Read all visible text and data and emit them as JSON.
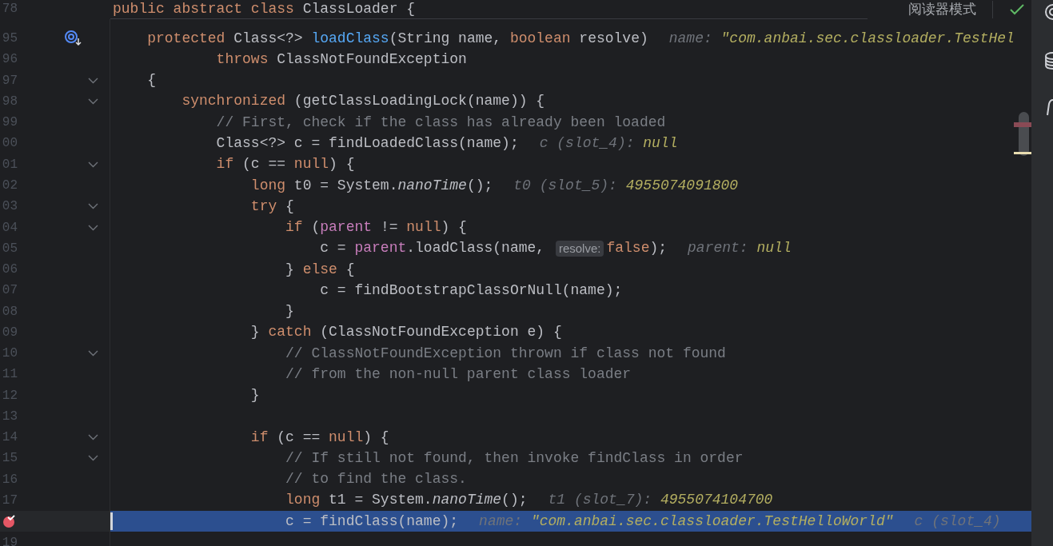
{
  "sticky_header": {
    "number": "78",
    "segments": [
      {
        "kind": "keyword",
        "text": "public abstract class "
      },
      {
        "kind": "plain",
        "text": "ClassLoader {"
      }
    ]
  },
  "editor_toolbar": {
    "reader_mode": "阅读器模式"
  },
  "lines": [
    {
      "number": "95",
      "gutter_icon": {
        "kind": "method_breakpoint"
      },
      "foldable": false,
      "highlighted": false,
      "segments": [
        {
          "kind": "keyword",
          "text": "    protected "
        },
        {
          "kind": "plain",
          "text": "Class<?> "
        },
        {
          "kind": "method",
          "text": "loadClass"
        },
        {
          "kind": "plain",
          "text": "(String name, "
        },
        {
          "kind": "keyword",
          "text": "boolean "
        },
        {
          "kind": "plain",
          "text": "resolve)"
        }
      ],
      "hints": [
        {
          "label": "name:",
          "value": "\"com.anbai.sec.classloader.TestHel"
        }
      ]
    },
    {
      "number": "96",
      "foldable": false,
      "highlighted": false,
      "segments": [
        {
          "kind": "keyword",
          "text": "            throws "
        },
        {
          "kind": "plain",
          "text": "ClassNotFoundException"
        }
      ]
    },
    {
      "number": "97",
      "foldable": true,
      "highlighted": false,
      "segments": [
        {
          "kind": "plain",
          "text": "    {"
        }
      ]
    },
    {
      "number": "98",
      "foldable": true,
      "highlighted": false,
      "segments": [
        {
          "kind": "keyword",
          "text": "        synchronized "
        },
        {
          "kind": "plain",
          "text": "(getClassLoadingLock(name)) {"
        }
      ]
    },
    {
      "number": "99",
      "foldable": false,
      "highlighted": false,
      "segments": [
        {
          "kind": "comment",
          "text": "            // First, check if the class has already been loaded"
        }
      ]
    },
    {
      "number": "00",
      "foldable": false,
      "highlighted": false,
      "segments": [
        {
          "kind": "plain",
          "text": "            Class<?> c = findLoadedClass(name);"
        }
      ],
      "hints": [
        {
          "label": "c (slot_4):",
          "value": "null"
        }
      ]
    },
    {
      "number": "01",
      "foldable": true,
      "highlighted": false,
      "segments": [
        {
          "kind": "keyword",
          "text": "            if "
        },
        {
          "kind": "plain",
          "text": "(c == "
        },
        {
          "kind": "keyword",
          "text": "null"
        },
        {
          "kind": "plain",
          "text": ") {"
        }
      ]
    },
    {
      "number": "02",
      "foldable": false,
      "highlighted": false,
      "segments": [
        {
          "kind": "keyword",
          "text": "                long "
        },
        {
          "kind": "plain",
          "text": "t0 = System."
        },
        {
          "kind": "static_call",
          "text": "nanoTime"
        },
        {
          "kind": "plain",
          "text": "();"
        }
      ],
      "hints": [
        {
          "label": "t0 (slot_5):",
          "value": "4955074091800"
        }
      ]
    },
    {
      "number": "03",
      "foldable": true,
      "highlighted": false,
      "segments": [
        {
          "kind": "keyword",
          "text": "                try "
        },
        {
          "kind": "plain",
          "text": "{"
        }
      ]
    },
    {
      "number": "04",
      "foldable": true,
      "highlighted": false,
      "segments": [
        {
          "kind": "keyword",
          "text": "                    if "
        },
        {
          "kind": "plain",
          "text": "("
        },
        {
          "kind": "field",
          "text": "parent"
        },
        {
          "kind": "plain",
          "text": " != "
        },
        {
          "kind": "keyword",
          "text": "null"
        },
        {
          "kind": "plain",
          "text": ") {"
        }
      ]
    },
    {
      "number": "05",
      "foldable": false,
      "highlighted": false,
      "segments": [
        {
          "kind": "plain",
          "text": "                        c = "
        },
        {
          "kind": "field",
          "text": "parent"
        },
        {
          "kind": "plain",
          "text": ".loadClass(name, "
        },
        {
          "kind": "param_hint",
          "text": "resolve:"
        },
        {
          "kind": "keyword",
          "text": "false"
        },
        {
          "kind": "plain",
          "text": ");"
        }
      ],
      "hints": [
        {
          "label": "parent:",
          "value": "null"
        }
      ]
    },
    {
      "number": "06",
      "foldable": false,
      "highlighted": false,
      "segments": [
        {
          "kind": "plain",
          "text": "                    } "
        },
        {
          "kind": "keyword",
          "text": "else "
        },
        {
          "kind": "plain",
          "text": "{"
        }
      ]
    },
    {
      "number": "07",
      "foldable": false,
      "highlighted": false,
      "segments": [
        {
          "kind": "plain",
          "text": "                        c = findBootstrapClassOrNull(name);"
        }
      ]
    },
    {
      "number": "08",
      "foldable": false,
      "highlighted": false,
      "segments": [
        {
          "kind": "plain",
          "text": "                    }"
        }
      ]
    },
    {
      "number": "09",
      "foldable": false,
      "highlighted": false,
      "segments": [
        {
          "kind": "plain",
          "text": "                } "
        },
        {
          "kind": "keyword",
          "text": "catch "
        },
        {
          "kind": "plain",
          "text": "(ClassNotFoundException e) {"
        }
      ]
    },
    {
      "number": "10",
      "foldable": true,
      "highlighted": false,
      "segments": [
        {
          "kind": "comment",
          "text": "                    // ClassNotFoundException thrown if class not found"
        }
      ]
    },
    {
      "number": "11",
      "foldable": false,
      "highlighted": false,
      "segments": [
        {
          "kind": "comment",
          "text": "                    // from the non-null parent class loader"
        }
      ]
    },
    {
      "number": "12",
      "foldable": false,
      "highlighted": false,
      "segments": [
        {
          "kind": "plain",
          "text": "                }"
        }
      ]
    },
    {
      "number": "13",
      "foldable": false,
      "highlighted": false
    },
    {
      "number": "14",
      "foldable": true,
      "highlighted": false,
      "segments": [
        {
          "kind": "keyword",
          "text": "                if "
        },
        {
          "kind": "plain",
          "text": "(c == "
        },
        {
          "kind": "keyword",
          "text": "null"
        },
        {
          "kind": "plain",
          "text": ") {"
        }
      ]
    },
    {
      "number": "15",
      "foldable": true,
      "highlighted": false,
      "segments": [
        {
          "kind": "comment",
          "text": "                    // If still not found, then invoke findClass in order"
        }
      ]
    },
    {
      "number": "16",
      "foldable": false,
      "highlighted": false,
      "segments": [
        {
          "kind": "comment",
          "text": "                    // to find the class."
        }
      ]
    },
    {
      "number": "17",
      "foldable": false,
      "highlighted": false,
      "segments": [
        {
          "kind": "keyword",
          "text": "                    long "
        },
        {
          "kind": "plain",
          "text": "t1 = System."
        },
        {
          "kind": "static_call",
          "text": "nanoTime"
        },
        {
          "kind": "plain",
          "text": "();"
        }
      ],
      "hints": [
        {
          "label": "t1 (slot_7):",
          "value": "4955074104700"
        }
      ]
    },
    {
      "gutter_icon": {
        "kind": "breakpoint"
      },
      "foldable": false,
      "highlighted": true,
      "segments": [
        {
          "kind": "plain",
          "text": "                    c = findClass(name);"
        }
      ],
      "hints": [
        {
          "label": "name:",
          "value": "\"com.anbai.sec.classloader.TestHelloWorld\""
        },
        {
          "label": "c (slot_4)"
        }
      ]
    },
    {
      "number": "19",
      "foldable": false,
      "highlighted": false
    }
  ]
}
